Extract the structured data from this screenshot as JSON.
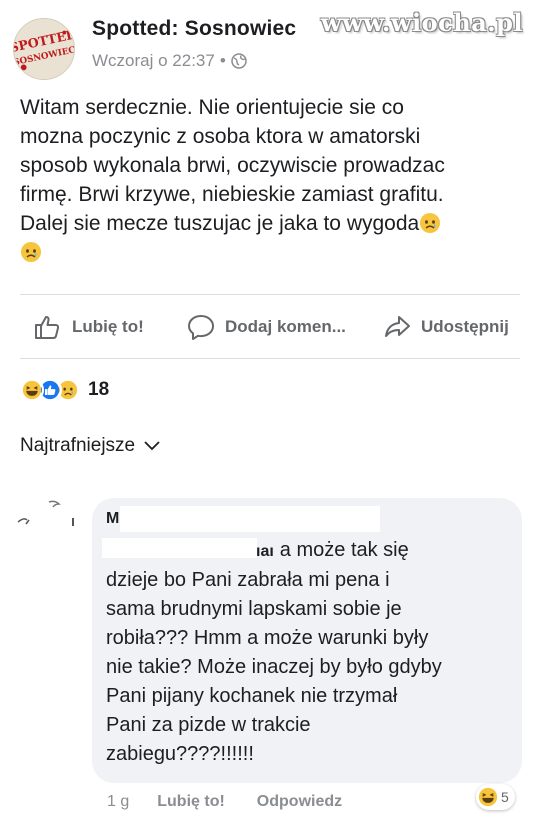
{
  "post": {
    "page_name": "Spotted: Sosnowiec",
    "timestamp": "Wczoraj o 22:37",
    "meta_separator": "•",
    "avatar_logo_text": "SPOTTED SOSNOWIEC",
    "privacy_icon": "globe-icon",
    "body_lines": [
      "Witam serdecznie. Nie orientujecie sie co",
      "mozna poczynic z osoba ktora w amatorski",
      "sposob wykonala brwi, oczywiscie prowadzac",
      "firmę. Brwi krzywe, niebieskie zamiast grafitu.",
      "Dalej sie mecze tuszujac je jaka to wygoda"
    ],
    "body_emoji": "crying-face-emoji"
  },
  "watermark": "www.wiocha.pl",
  "actions": {
    "like_label": "Lubię to!",
    "comment_label": "Dodaj komen...",
    "share_label": "Udostępnij",
    "like_icon": "thumbs-up-icon",
    "comment_icon": "speech-bubble-icon",
    "share_icon": "share-arrow-icon"
  },
  "reactions": {
    "types": [
      "haha",
      "like",
      "sad"
    ],
    "count": "18"
  },
  "comments": {
    "sort_label": "Najtrafniejsze",
    "sort_icon": "chevron-down-icon",
    "items": [
      {
        "author_visible": "M",
        "name_fragment": "ıaı",
        "text_lines": [
          "a może tak się",
          "dzieje bo Pani zabrała mi pena i",
          "sama brudnymi lapskami sobie je",
          "robiła??? Hmm a może warunki były",
          "nie takie? Może inaczej by było gdyby",
          "Pani pijany kochanek nie trzymał",
          "Pani za pizde w trakcie",
          "zabiegu????!!!!!!"
        ],
        "time": "1 g",
        "like_label": "Lubię to!",
        "reply_label": "Odpowiedz",
        "reaction_type": "haha",
        "reaction_count": "5"
      }
    ]
  },
  "colors": {
    "text": "#1c1e21",
    "secondary": "#65676b",
    "muted": "#8a8d91",
    "bubble": "#f0f2f5",
    "like_blue": "#1877f2",
    "emoji_yellow": "#f7c43d"
  }
}
